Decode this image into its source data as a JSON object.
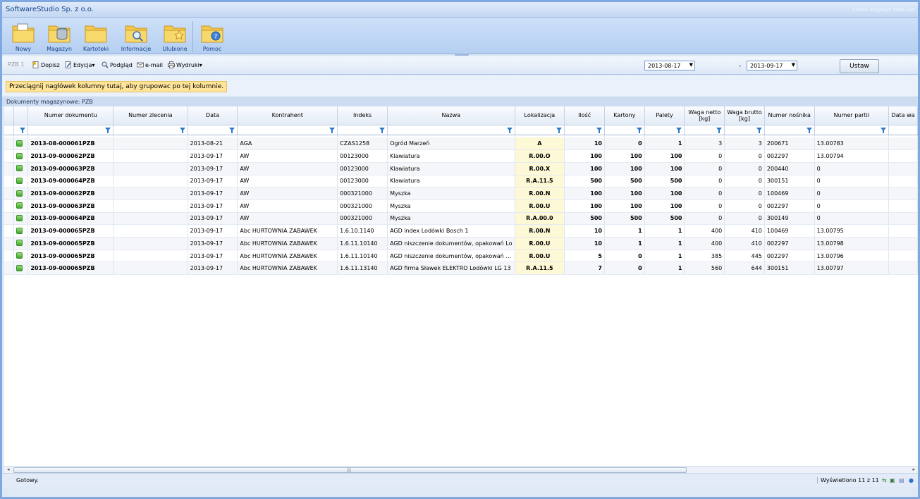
{
  "window": {
    "title": "SoftwareStudio Sp. z o.o.",
    "product": "Studio Magazyn WMS.net"
  },
  "ribbon": {
    "buttons": [
      {
        "label": "Nowy",
        "icon": "new-document-folder-icon"
      },
      {
        "label": "Magazyn",
        "icon": "warehouse-database-folder-icon"
      },
      {
        "label": "Kartoteki",
        "icon": "folder-icon"
      },
      {
        "label": "Informacje",
        "icon": "search-folder-icon"
      },
      {
        "label": "Ulubione",
        "icon": "star-folder-icon"
      },
      {
        "label": "Pomoc",
        "icon": "help-folder-icon"
      }
    ]
  },
  "toolbar": {
    "doc_type": "PZB",
    "doc_num": "1",
    "dopisz": "Dopisz",
    "edycja": "Edycja",
    "podglad": "Podgląd",
    "email": "e-mail",
    "wydruki": "Wydruki",
    "date_from": "2013-08-17",
    "date_sep": "-",
    "date_to": "2013-09-17",
    "ustaw": "Ustaw"
  },
  "group_hint": "Przeciągnij nagłówek kolumny tutaj, aby grupowac po tej kolumnie.",
  "grid": {
    "caption": "Dokumenty magazynowe: PZB",
    "columns": [
      "Numer dokumentu",
      "Numer zlecenia",
      "Data",
      "Kontrahent",
      "Indeks",
      "Nazwa",
      "Lokalizacja",
      "Ilość",
      "Kartony",
      "Palety",
      "Waga netto [kg]",
      "Waga brutto [kg]",
      "Numer nośnika",
      "Numer partii",
      "Data wa"
    ],
    "rows": [
      [
        "2013-08-000061PZB",
        "",
        "2013-08-21",
        "AGA",
        "CZAS1258",
        "Ogród Marzeń",
        "A",
        "10",
        "0",
        "1",
        "3",
        "3",
        "200671",
        "13.00783",
        ""
      ],
      [
        "2013-09-000062PZB",
        "",
        "2013-09-17",
        "AW",
        "00123000",
        "Klawiatura",
        "R.00.O",
        "100",
        "100",
        "100",
        "0",
        "0",
        "002297",
        "13.00794",
        ""
      ],
      [
        "2013-09-000063PZB",
        "",
        "2013-09-17",
        "AW",
        "00123000",
        "Klawiatura",
        "R.00.X",
        "100",
        "100",
        "100",
        "0",
        "0",
        "200440",
        "0",
        ""
      ],
      [
        "2013-09-000064PZB",
        "",
        "2013-09-17",
        "AW",
        "00123000",
        "Klawiatura",
        "R.A.11.5",
        "500",
        "500",
        "500",
        "0",
        "0",
        "300151",
        "0",
        ""
      ],
      [
        "2013-09-000062PZB",
        "",
        "2013-09-17",
        "AW",
        "000321000",
        "Myszka",
        "R.00.N",
        "100",
        "100",
        "100",
        "0",
        "0",
        "100469",
        "0",
        ""
      ],
      [
        "2013-09-000063PZB",
        "",
        "2013-09-17",
        "AW",
        "000321000",
        "Myszka",
        "R.00.U",
        "100",
        "100",
        "100",
        "0",
        "0",
        "002297",
        "0",
        ""
      ],
      [
        "2013-09-000064PZB",
        "",
        "2013-09-17",
        "AW",
        "000321000",
        "Myszka",
        "R.A.00.0",
        "500",
        "500",
        "500",
        "0",
        "0",
        "300149",
        "0",
        ""
      ],
      [
        "2013-09-000065PZB",
        "",
        "2013-09-17",
        "Abc HURTOWNIA ZABAWEK",
        "1.6.10.1140",
        "AGD index Lodówki Bosch 1",
        "R.00.N",
        "10",
        "1",
        "1",
        "400",
        "410",
        "100469",
        "13.00795",
        ""
      ],
      [
        "2013-09-000065PZB",
        "",
        "2013-09-17",
        "Abc HURTOWNIA ZABAWEK",
        "1.6.11.10140",
        "AGD niszczenie dokumentów, opakowań Lo",
        "R.00.U",
        "10",
        "1",
        "1",
        "400",
        "410",
        "002297",
        "13.00798",
        ""
      ],
      [
        "2013-09-000065PZB",
        "",
        "2013-09-17",
        "Abc HURTOWNIA ZABAWEK",
        "1.6.11.10140",
        "AGD niszczenie dokumentów, opakowań ...",
        "R.00.U",
        "5",
        "0",
        "1",
        "385",
        "445",
        "002297",
        "13.00796",
        ""
      ],
      [
        "2013-09-000065PZB",
        "",
        "2013-09-17",
        "Abc HURTOWNIA ZABAWEK",
        "1.6.11.13140",
        "AGD firma Sławek ELEKTRO Lodówki LG 13",
        "R.A.11.5",
        "7",
        "0",
        "1",
        "560",
        "644",
        "300151",
        "13.00797",
        ""
      ]
    ]
  },
  "statusbar": {
    "ready": "Gotowy.",
    "count": "Wyświetlono 11 z 11"
  },
  "colors": {
    "accent": "#15428b",
    "highlight": "#ffe49a",
    "location_bg": "#fdf8d6",
    "status_green": "#3fa52c"
  }
}
